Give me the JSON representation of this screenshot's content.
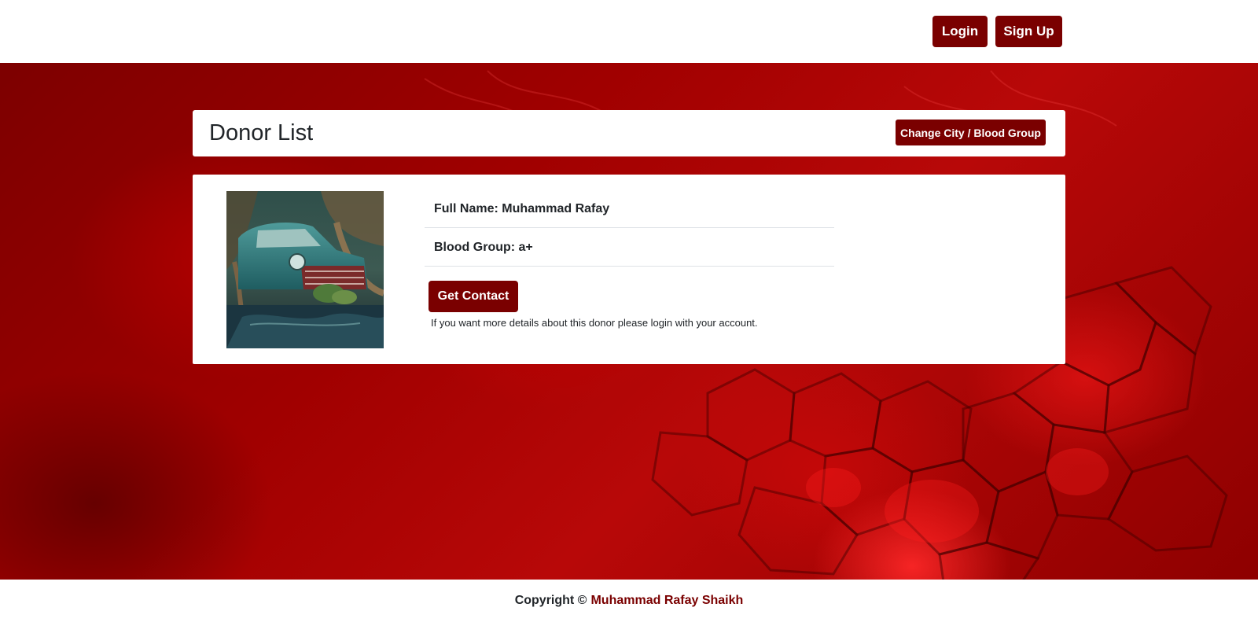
{
  "navbar": {
    "login_label": "Login",
    "signup_label": "Sign Up"
  },
  "header": {
    "title": "Donor List",
    "change_button_label": "Change City / Blood Group"
  },
  "donor": {
    "full_name_label": "Full Name: Muhammad Rafay",
    "blood_group_label": "Blood Group: a+",
    "contact_button_label": "Get Contact",
    "note": "If you want more details about this donor please login with your account."
  },
  "footer": {
    "copyright_prefix": "Copyright ©",
    "author": "Muhammad Rafay Shaikh"
  },
  "colors": {
    "accent": "#7a0000",
    "background_red": "#a00000",
    "text": "#212529"
  }
}
